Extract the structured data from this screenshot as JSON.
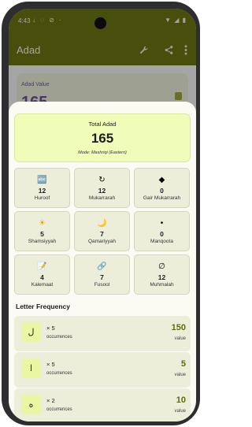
{
  "status": {
    "time": "4:43",
    "left_icons": "↓ ◌ ⊘ ·",
    "right_icons": "▼ ◢ ▮"
  },
  "app": {
    "title": "Adad"
  },
  "background": {
    "label": "Adad Value",
    "value": "165"
  },
  "total": {
    "label": "Total Adad",
    "value": "165",
    "mode": "Mode: Mashriqi (Eastern)"
  },
  "stats": [
    {
      "icon": "abc-icon",
      "glyph": "🔤",
      "value": "12",
      "label": "Huroof"
    },
    {
      "icon": "repeat-icon",
      "glyph": "↻",
      "value": "12",
      "label": "Mukarrarah"
    },
    {
      "icon": "diamond-icon",
      "glyph": "◆",
      "value": "0",
      "label": "Gair Mukarrarah"
    },
    {
      "icon": "sun-icon",
      "glyph": "☀",
      "value": "5",
      "label": "Shamsiyyah"
    },
    {
      "icon": "moon-icon",
      "glyph": "🌙",
      "value": "7",
      "label": "Qamariyyah"
    },
    {
      "icon": "dot-icon",
      "glyph": "•",
      "value": "0",
      "label": "Manqoota"
    },
    {
      "icon": "memo-icon",
      "glyph": "📝",
      "value": "4",
      "label": "Kalemaat"
    },
    {
      "icon": "link-icon",
      "glyph": "🔗",
      "value": "7",
      "label": "Fusool"
    },
    {
      "icon": "empty-set-icon",
      "glyph": "∅",
      "value": "12",
      "label": "Muhmalah"
    }
  ],
  "frequency": {
    "title": "Letter Frequency",
    "rows": [
      {
        "letter": "ل",
        "count": "× 5",
        "occurrences": "occurrences",
        "value": "150",
        "value_label": "value"
      },
      {
        "letter": "ا",
        "count": "× 5",
        "occurrences": "occurrences",
        "value": "5",
        "value_label": "value"
      },
      {
        "letter": "ه",
        "count": "× 2",
        "occurrences": "occurrences",
        "value": "10",
        "value_label": "value"
      }
    ]
  },
  "colors": {
    "primary": "#6a7413",
    "accent_fill": "#f0fdb8",
    "value_text": "#5d6b10"
  }
}
